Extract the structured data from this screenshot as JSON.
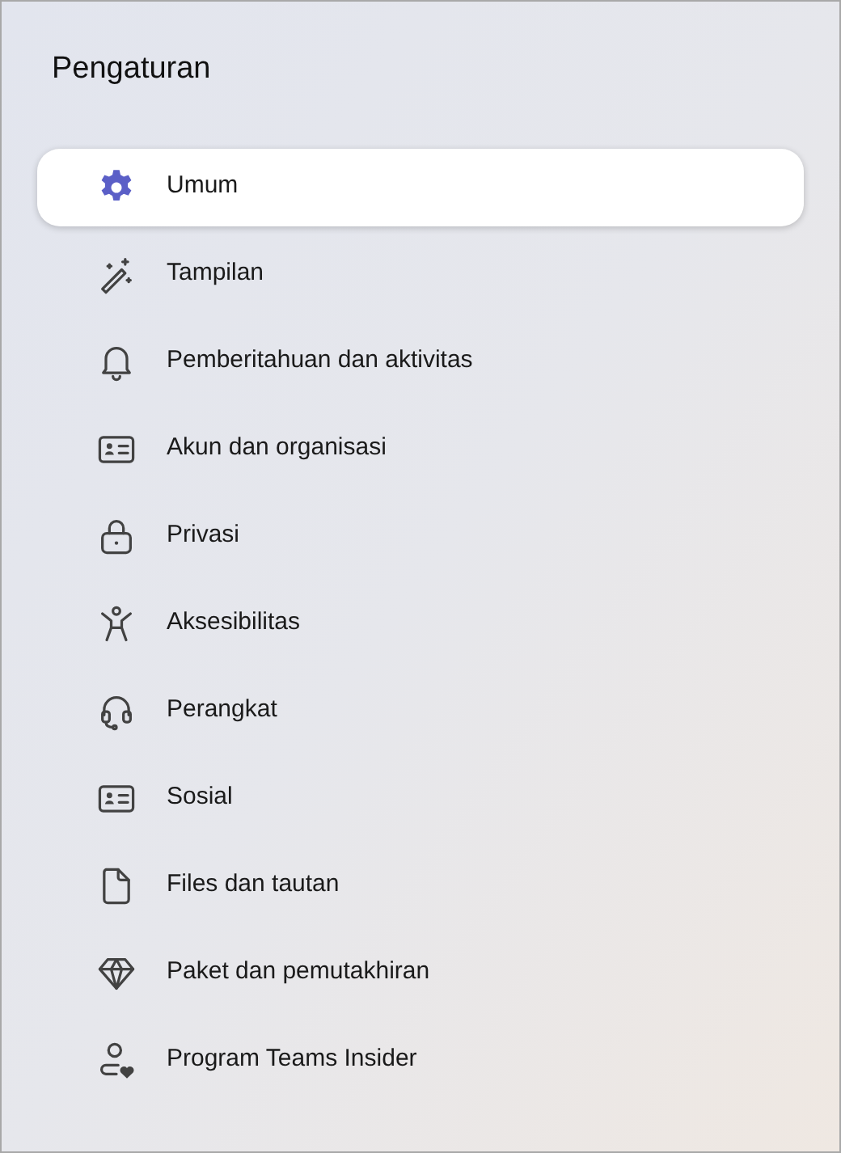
{
  "title": "Pengaturan",
  "items": [
    {
      "label": "Umum",
      "selected": true
    },
    {
      "label": "Tampilan",
      "selected": false
    },
    {
      "label": "Pemberitahuan dan aktivitas",
      "selected": false
    },
    {
      "label": "Akun dan organisasi",
      "selected": false
    },
    {
      "label": "Privasi",
      "selected": false
    },
    {
      "label": "Aksesibilitas",
      "selected": false
    },
    {
      "label": "Perangkat",
      "selected": false
    },
    {
      "label": "Sosial",
      "selected": false
    },
    {
      "label": "Files dan tautan",
      "selected": false
    },
    {
      "label": "Paket dan pemutakhiran",
      "selected": false
    },
    {
      "label": "Program Teams Insider",
      "selected": false
    }
  ]
}
